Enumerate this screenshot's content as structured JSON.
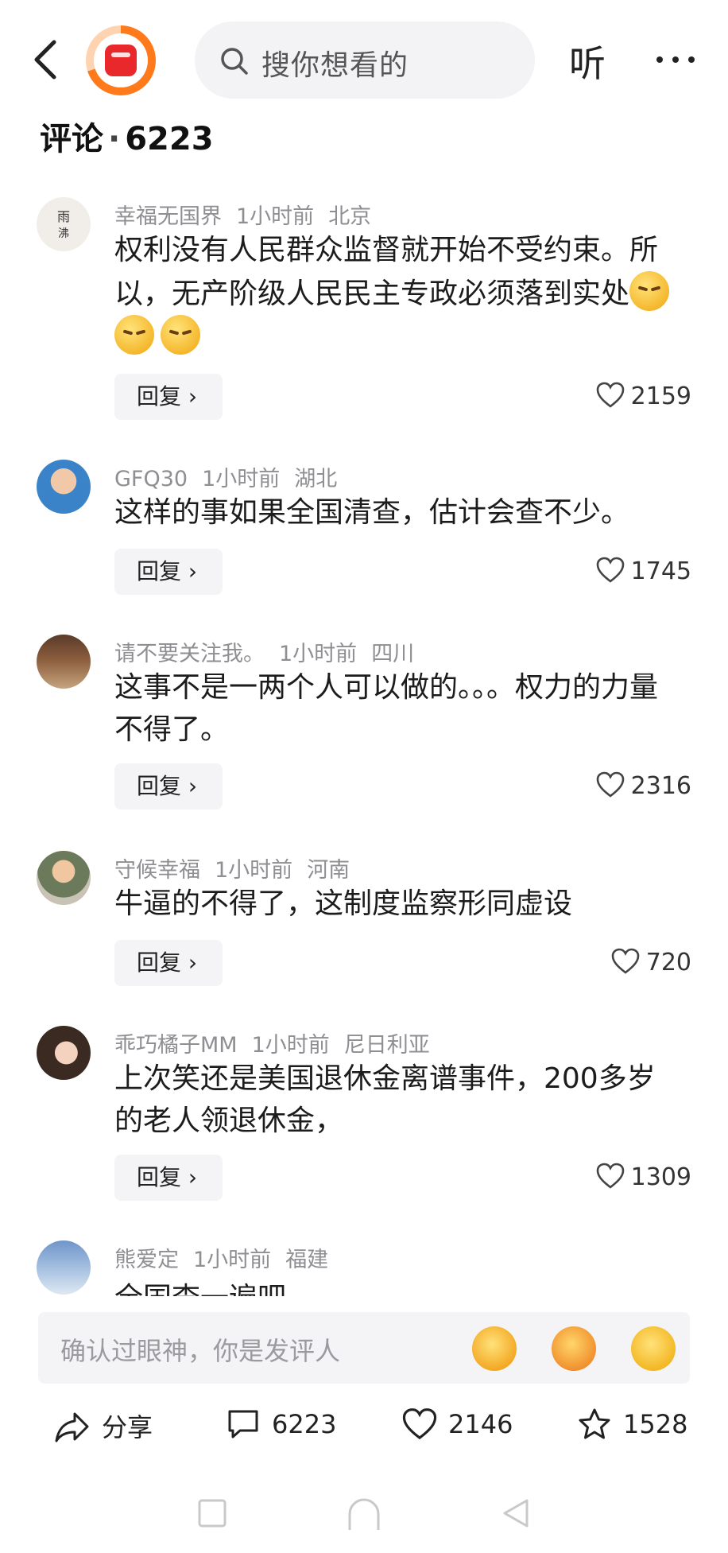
{
  "header": {
    "search_placeholder": "搜你想看的",
    "listen_label": "听",
    "comments_label": "评论",
    "comments_count": "6223"
  },
  "comments": [
    {
      "user": "幸福无国界",
      "time": "1小时前",
      "location": "北京",
      "text": "权利没有人民群众监督就开始不受约束。所以，无产阶级人民民主专政必须落到实处",
      "reply_label": "回复 ›",
      "likes": "2159"
    },
    {
      "user": "GFQ30",
      "time": "1小时前",
      "location": "湖北",
      "text": "这样的事如果全国清查，估计会查不少。",
      "reply_label": "回复 ›",
      "likes": "1745"
    },
    {
      "user": "请不要关注我。",
      "time": "1小时前",
      "location": "四川",
      "text": "这事不是一两个人可以做的。。。权力的力量不得了。",
      "reply_label": "回复 ›",
      "likes": "2316"
    },
    {
      "user": "守候幸福",
      "time": "1小时前",
      "location": "河南",
      "text": "牛逼的不得了，这制度监察形同虚设",
      "reply_label": "回复 ›",
      "likes": "720"
    },
    {
      "user": "乖巧橘子MM",
      "time": "1小时前",
      "location": "尼日利亚",
      "text": "上次笑还是美国退休金离谱事件，200多岁的老人领退休金，",
      "reply_label": "回复 ›",
      "likes": "1309"
    },
    {
      "user": "熊爱定",
      "time": "1小时前",
      "location": "福建",
      "text": "全国查一遍吧"
    }
  ],
  "comment_input": {
    "placeholder": "确认过眼神，你是发评人"
  },
  "actions": {
    "share_label": "分享",
    "comment_count": "6223",
    "like_count": "2146",
    "favorite_count": "1528"
  },
  "colors": {
    "accent": "#e8282b",
    "logo_ring": "#ff7a1a",
    "muted": "#8e8e93"
  }
}
